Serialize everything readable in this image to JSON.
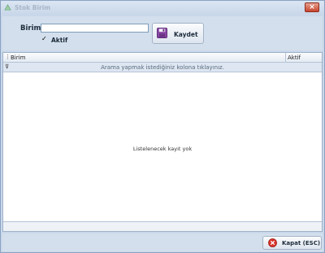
{
  "window": {
    "title": "Stok Birim",
    "close_glyph": "×"
  },
  "form": {
    "birim_label": "Birim",
    "birim_value": "",
    "aktif_checked_glyph": "✓",
    "aktif_label": "Aktif",
    "save_label": "Kaydet",
    "save_icon": "floppy-disk-icon"
  },
  "grid": {
    "columns": [
      "Birim",
      "Aktif"
    ],
    "filter_hint": "Arama yapmak istediğiniz kolona tıklayınız.",
    "empty_message": "Listelenecek kayıt yok"
  },
  "footer": {
    "close_label": "Kapat (ESC)",
    "close_icon": "red-x-circle-icon"
  }
}
